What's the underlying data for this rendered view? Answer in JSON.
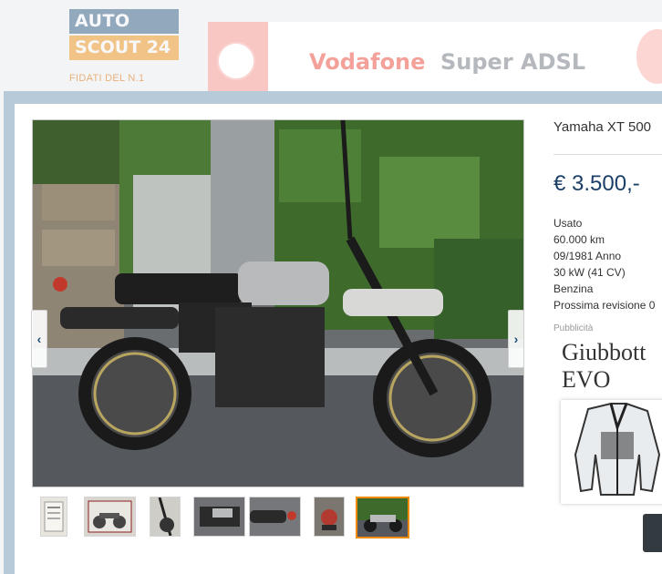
{
  "background": {
    "logo": {
      "line1": "AUTO",
      "line2": "SCOUT 24",
      "tagline": "FIDATI DEL N.1"
    },
    "ad_banner": {
      "brand": "Vodafone",
      "product": "Super ADSL"
    }
  },
  "listing": {
    "title": "Yamaha XT 500",
    "price": "€ 3.500,-",
    "specs": [
      "Usato",
      "60.000 km",
      "09/1981 Anno",
      "30 kW (41 CV)",
      "Benzina",
      "Prossima revisione 0"
    ]
  },
  "gallery": {
    "prev_glyph": "‹",
    "next_glyph": "›",
    "thumbnail_count": 7,
    "active_thumbnail": 7
  },
  "sidebar_ad": {
    "label": "Pubblicità",
    "title_line1": "Giubbott",
    "title_line2": "EVO"
  },
  "colors": {
    "accent": "#1c3f68",
    "active_border": "#f08a00",
    "modal_frame": "#b7cad9"
  }
}
